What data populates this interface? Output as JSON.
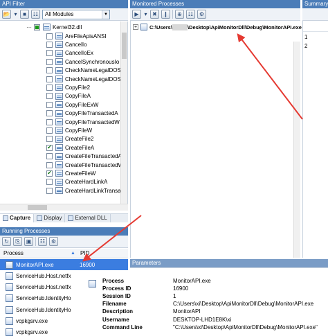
{
  "api_filter": {
    "title": "API Filter",
    "module_filter": "All Modules",
    "module": "Kernel32.dll",
    "functions": [
      {
        "name": "AreFileApisANSI",
        "checked": false
      },
      {
        "name": "CancelIo",
        "checked": false
      },
      {
        "name": "CancelIoEx",
        "checked": false
      },
      {
        "name": "CancelSynchronousIo",
        "checked": false
      },
      {
        "name": "CheckNameLegalDOS",
        "checked": false
      },
      {
        "name": "CheckNameLegalDOS",
        "checked": false
      },
      {
        "name": "CopyFile2",
        "checked": false
      },
      {
        "name": "CopyFileA",
        "checked": false
      },
      {
        "name": "CopyFileExW",
        "checked": false
      },
      {
        "name": "CopyFileTransactedA",
        "checked": false
      },
      {
        "name": "CopyFileTransactedW",
        "checked": false
      },
      {
        "name": "CopyFileW",
        "checked": false
      },
      {
        "name": "CreateFile2",
        "checked": false
      },
      {
        "name": "CreateFileA",
        "checked": true
      },
      {
        "name": "CreateFileTransactedA",
        "checked": false
      },
      {
        "name": "CreateFileTransactedW",
        "checked": false
      },
      {
        "name": "CreateFileW",
        "checked": true
      },
      {
        "name": "CreateHardLinkA",
        "checked": false
      },
      {
        "name": "CreateHardLinkTransa",
        "checked": false
      }
    ],
    "tabs": [
      {
        "label": "Capture",
        "active": true
      },
      {
        "label": "Display",
        "active": false
      },
      {
        "label": "External DLL",
        "active": false
      }
    ]
  },
  "monitored": {
    "title": "Monitored Processes",
    "path_prefix": "C:\\Users\\",
    "path_suffix": "\\Desktop\\ApiMonitorDll\\Debug\\MonitorAPI.exe"
  },
  "summary": {
    "title": "Summary",
    "rows": [
      "1",
      "2"
    ]
  },
  "running": {
    "title": "Running Processes",
    "col_process": "Process",
    "col_pid": "PID",
    "rows": [
      {
        "name": "MonitorAPI.exe",
        "pid": "16900",
        "selected": true
      },
      {
        "name": "ServiceHub.Host.netfx",
        "pid": "",
        "selected": false
      },
      {
        "name": "ServiceHub.Host.netfx",
        "pid": "",
        "selected": false
      },
      {
        "name": "ServiceHub.IdentityHo",
        "pid": "",
        "selected": false
      },
      {
        "name": "ServiceHub.IdentityHo",
        "pid": "",
        "selected": false
      },
      {
        "name": "vcpkgsrv.exe",
        "pid": "",
        "selected": false
      },
      {
        "name": "vcpkgsrv.exe",
        "pid": "",
        "selected": false
      }
    ]
  },
  "parameters": {
    "title": "Parameters",
    "rows": [
      {
        "key": "Process",
        "value": "MonitorAPI.exe"
      },
      {
        "key": "Process ID",
        "value": "16900"
      },
      {
        "key": "Session ID",
        "value": "1"
      },
      {
        "key": "Filename",
        "value": "C:\\Users\\xi\\Desktop\\ApiMonitorDll\\Debug\\MonitorAPI.exe"
      },
      {
        "key": "Description",
        "value": "MonitorAPI"
      },
      {
        "key": "Username",
        "value": "DESKTOP-LHD1E8K\\xi"
      },
      {
        "key": "Command Line",
        "value": "\"C:\\Users\\xi\\Desktop\\ApiMonitorDll\\Debug\\MonitorAPI.exe\""
      }
    ]
  },
  "colors": {
    "title_bar": "#4b7db8",
    "selection": "#3b7de0",
    "arrow": "#e53a32"
  }
}
